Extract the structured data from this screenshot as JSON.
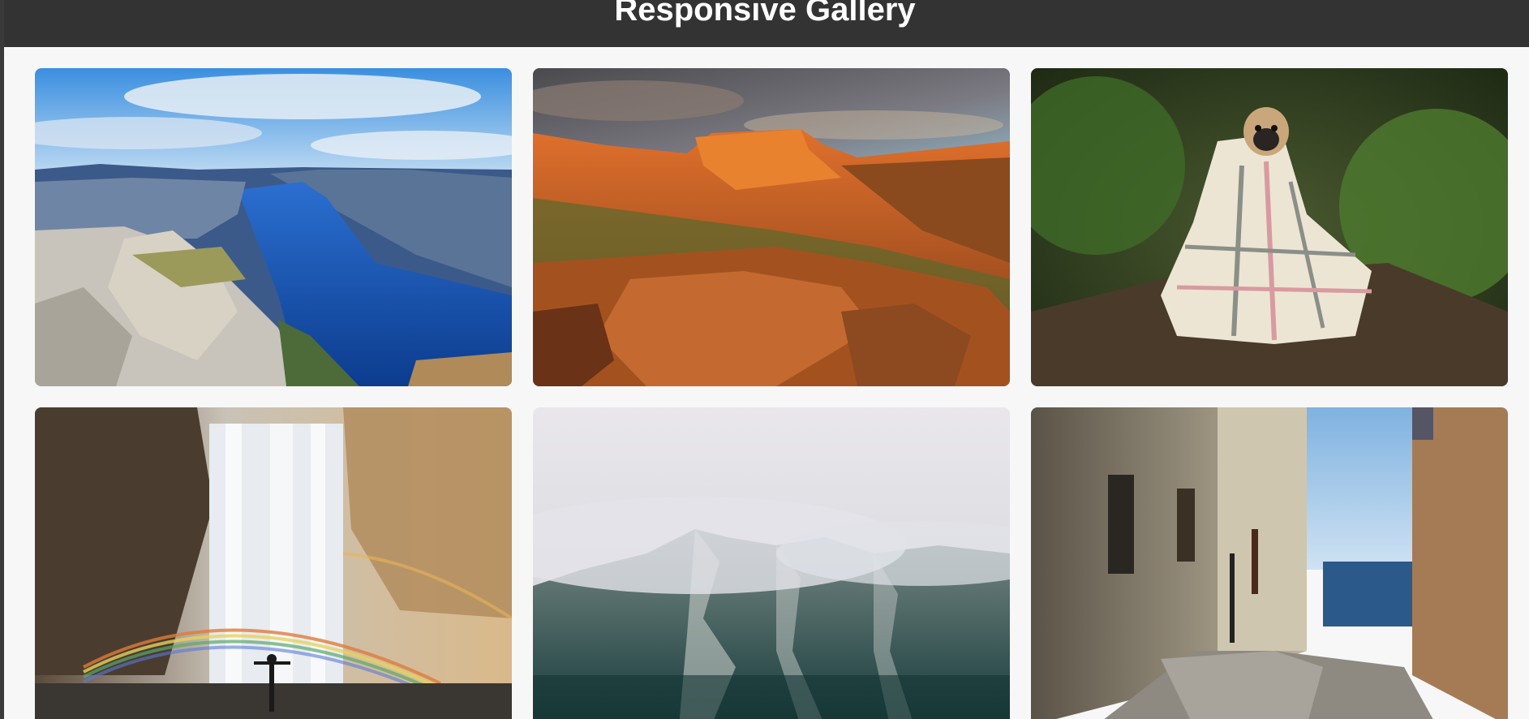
{
  "header": {
    "title": "Responsive Gallery"
  },
  "gallery": {
    "images": [
      {
        "subject": "fjord-cliff"
      },
      {
        "subject": "red-rock-canyon-sunset"
      },
      {
        "subject": "pug-in-blanket"
      },
      {
        "subject": "waterfall-with-rainbow"
      },
      {
        "subject": "misty-mountain"
      },
      {
        "subject": "narrow-alley-to-sea"
      }
    ]
  },
  "colors": {
    "header_bg": "#333333",
    "page_bg": "#f7f7f7",
    "title_text": "#ffffff"
  }
}
